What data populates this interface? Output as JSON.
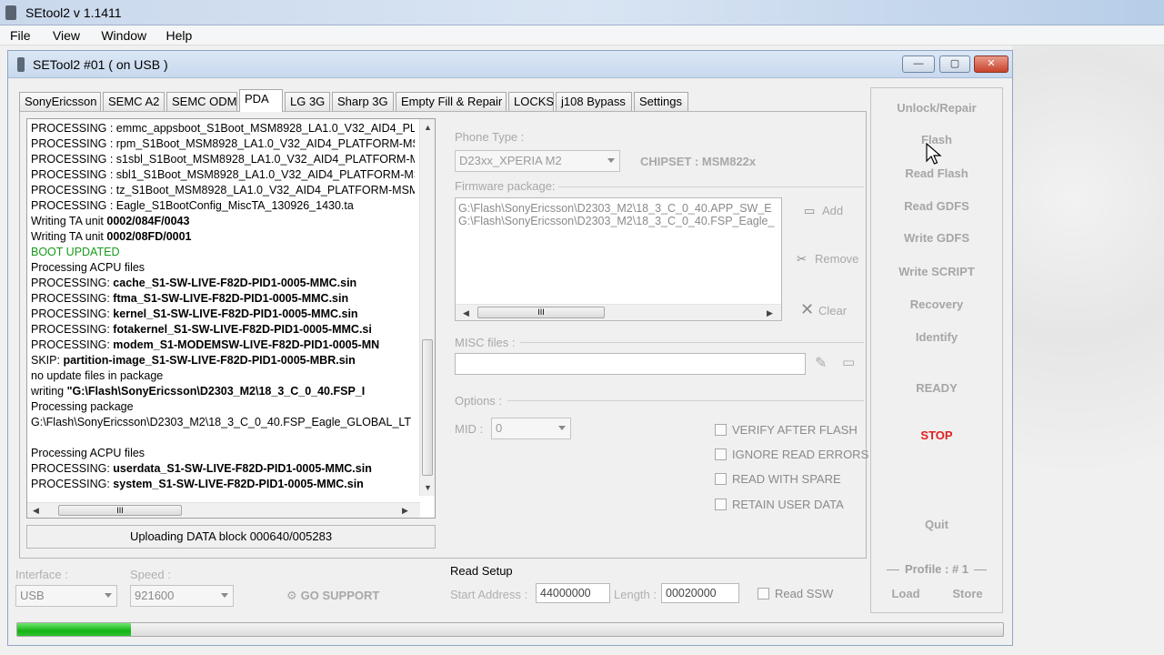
{
  "app": {
    "window_title": "SEtool2 v 1.1411"
  },
  "menu": [
    "File",
    "View",
    "Window",
    "Help"
  ],
  "child_window": {
    "title": "SETool2 #01 ( on USB )",
    "buttons": {
      "minimize": "—",
      "maximize": "▢",
      "close": "✕"
    }
  },
  "tabs": [
    "SonyEricsson",
    "SEMC A2",
    "SEMC ODM",
    "PDA",
    "LG 3G",
    "Sharp 3G",
    "Empty Fill & Repair",
    "LOCKS",
    "j108 Bypass",
    "Settings"
  ],
  "active_tab": "PDA",
  "log": [
    {
      "pre": "PROCESSING : emmc_appsboot_S1Boot_MSM8928_LA1.0_V32_AID4_PL",
      "bold": "",
      "color": ""
    },
    {
      "pre": "PROCESSING : rpm_S1Boot_MSM8928_LA1.0_V32_AID4_PLATFORM-MS",
      "bold": "",
      "color": ""
    },
    {
      "pre": "PROCESSING : s1sbl_S1Boot_MSM8928_LA1.0_V32_AID4_PLATFORM-M",
      "bold": "",
      "color": ""
    },
    {
      "pre": "PROCESSING : sbl1_S1Boot_MSM8928_LA1.0_V32_AID4_PLATFORM-MS",
      "bold": "",
      "color": ""
    },
    {
      "pre": "PROCESSING : tz_S1Boot_MSM8928_LA1.0_V32_AID4_PLATFORM-MSM",
      "bold": "",
      "color": ""
    },
    {
      "pre": "PROCESSING : Eagle_S1BootConfig_MiscTA_130926_1430.ta",
      "bold": "",
      "color": ""
    },
    {
      "pre": "Writing TA unit ",
      "bold": "0002/084F/0043",
      "color": ""
    },
    {
      "pre": "Writing TA unit ",
      "bold": "0002/08FD/0001",
      "color": ""
    },
    {
      "pre": "BOOT UPDATED",
      "bold": "",
      "color": "green"
    },
    {
      "pre": "Processing ACPU files",
      "bold": "",
      "color": ""
    },
    {
      "pre": "PROCESSING: ",
      "bold": "cache_S1-SW-LIVE-F82D-PID1-0005-MMC.sin",
      "color": ""
    },
    {
      "pre": "PROCESSING: ",
      "bold": "ftma_S1-SW-LIVE-F82D-PID1-0005-MMC.sin",
      "color": ""
    },
    {
      "pre": "PROCESSING: ",
      "bold": "kernel_S1-SW-LIVE-F82D-PID1-0005-MMC.sin",
      "color": ""
    },
    {
      "pre": "PROCESSING: ",
      "bold": "fotakernel_S1-SW-LIVE-F82D-PID1-0005-MMC.si",
      "color": ""
    },
    {
      "pre": "PROCESSING: ",
      "bold": "modem_S1-MODEMSW-LIVE-F82D-PID1-0005-MN",
      "color": ""
    },
    {
      "pre": "SKIP: ",
      "bold": "partition-image_S1-SW-LIVE-F82D-PID1-0005-MBR.sin",
      "color": ""
    },
    {
      "pre": "no update files in package",
      "bold": "",
      "color": ""
    },
    {
      "pre": "writing ",
      "bold": "\"G:\\Flash\\SonyEricsson\\D2303_M2\\18_3_C_0_40.FSP_I",
      "color": ""
    },
    {
      "pre": "Processing package",
      "bold": "",
      "color": ""
    },
    {
      "pre": "G:\\Flash\\SonyEricsson\\D2303_M2\\18_3_C_0_40.FSP_Eagle_GLOBAL_LT",
      "bold": "",
      "color": ""
    },
    {
      "pre": "",
      "bold": "",
      "color": ""
    },
    {
      "pre": "Processing ACPU files",
      "bold": "",
      "color": ""
    },
    {
      "pre": "PROCESSING: ",
      "bold": "userdata_S1-SW-LIVE-F82D-PID1-0005-MMC.sin",
      "color": ""
    },
    {
      "pre": "PROCESSING: ",
      "bold": "system_S1-SW-LIVE-F82D-PID1-0005-MMC.sin",
      "color": ""
    }
  ],
  "scroll_grip": "III",
  "status_text": "Uploading DATA block 000640/005283",
  "phone_type": {
    "label": "Phone Type :",
    "value": "D23xx_XPERIA M2",
    "chipset": "CHIPSET : MSM822x"
  },
  "firmware": {
    "label": "Firmware package:",
    "files": [
      "G:\\Flash\\SonyEricsson\\D2303_M2\\18_3_C_0_40.APP_SW_E",
      "G:\\Flash\\SonyEricsson\\D2303_M2\\18_3_C_0_40.FSP_Eagle_"
    ],
    "add_label": "Add",
    "remove_label": "Remove",
    "clear_label": "Clear"
  },
  "misc": {
    "label": "MISC files :"
  },
  "options": {
    "label": "Options :",
    "mid_label": "MID :",
    "mid_value": "0",
    "checkboxes": [
      "VERIFY AFTER FLASH",
      "IGNORE READ ERRORS",
      "READ WITH SPARE",
      "RETAIN USER DATA"
    ]
  },
  "actions": [
    "Unlock/Repair",
    "Flash",
    "Read Flash",
    "Read GDFS",
    "Write GDFS",
    "Write SCRIPT",
    "Recovery",
    "Identify"
  ],
  "ready_label": "READY",
  "stop_label": "STOP",
  "quit_label": "Quit",
  "profile": {
    "label": "Profile :  # 1",
    "load": "Load",
    "store": "Store"
  },
  "interface": {
    "label": "Interface :",
    "value": "USB"
  },
  "speed": {
    "label": "Speed :",
    "value": "921600"
  },
  "go_support": "GO SUPPORT",
  "read_setup": {
    "title": "Read Setup",
    "start_label": "Start Address :",
    "start_value": "44000000",
    "length_label": "Length :",
    "length_value": "00020000",
    "ssw_label": "Read SSW"
  },
  "progress": {
    "fraction": 0.115
  },
  "colors": {
    "stop": "#e02020",
    "boot_updated": "#1a9a1a",
    "progress": "#15b315"
  }
}
